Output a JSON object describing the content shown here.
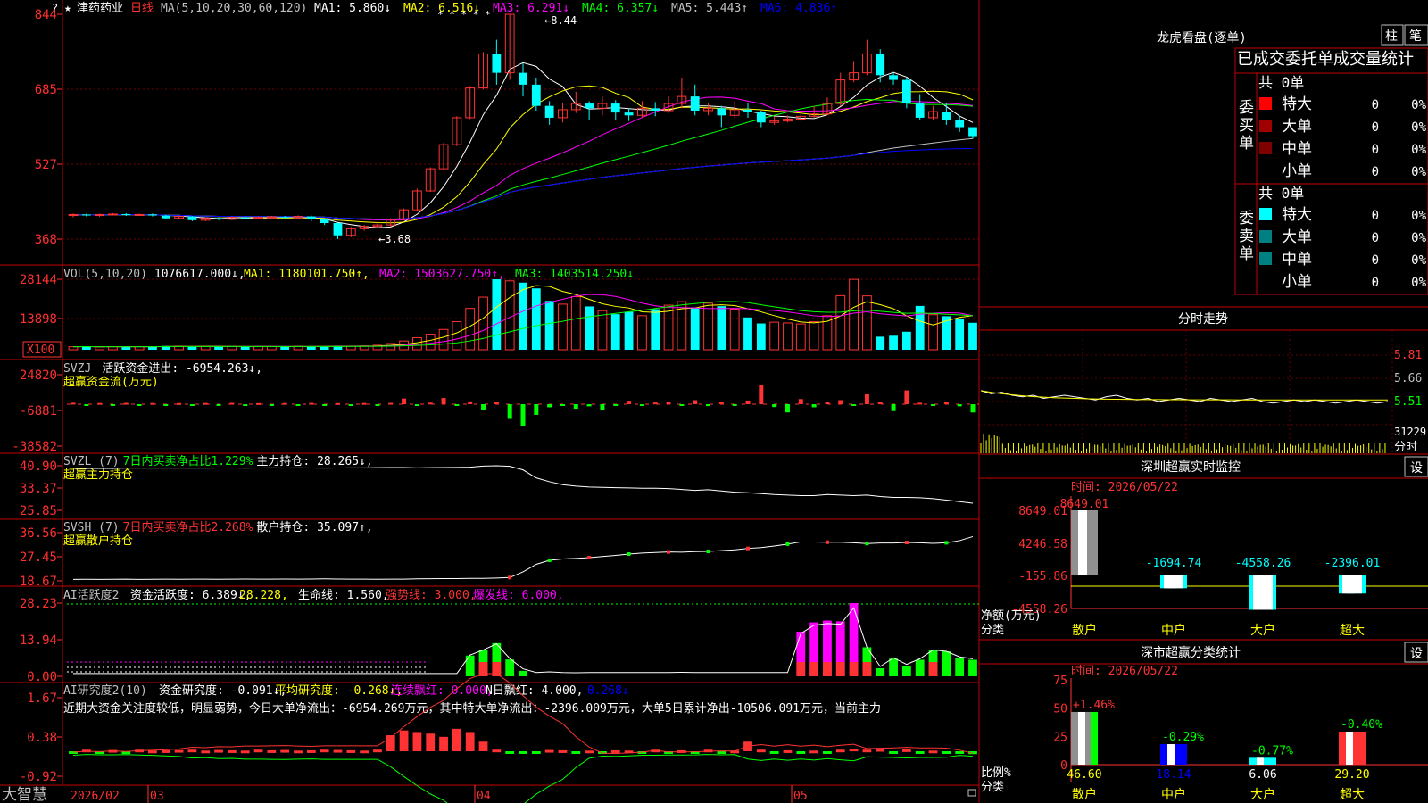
{
  "colors": {
    "up": "#ff3333",
    "down": "#00ffff",
    "ma1": "#ffffff",
    "ma2": "#ffff00",
    "ma3": "#ff00ff",
    "ma4": "#00ff00",
    "ma5": "#c0c0c0",
    "ma6": "#0000ff",
    "grid": "#800000",
    "axis": "#ff3030",
    "text": "#c0c0c0",
    "yellow": "#ffff00",
    "green": "#00ff00",
    "cyan": "#00ffff",
    "magenta": "#ff00ff",
    "white": "#ffffff"
  },
  "main": {
    "stock_name": "津药药业",
    "period": "日线",
    "ma_title": "MA(5,10,20,30,60,120)",
    "ma_values": [
      {
        "label": "MA1: 5.860↓",
        "color": "#ffffff"
      },
      {
        "label": "MA2: 6.516↓",
        "color": "#ffff00"
      },
      {
        "label": "MA3: 6.291↓",
        "color": "#ff00ff"
      },
      {
        "label": "MA4: 6.357↓",
        "color": "#00ff00"
      },
      {
        "label": "MA5: 5.443↑",
        "color": "#c0c0c0"
      },
      {
        "label": "MA6: 4.836↑",
        "color": "#0000ff"
      }
    ],
    "y_ticks": [
      "844",
      "685",
      "527",
      "368"
    ],
    "high_label": "8.44",
    "low_label": "3.68",
    "star_marks": "* * * * *",
    "question_mark": "?"
  },
  "vol": {
    "title": "VOL(5,10,20)",
    "value": "1076617.000↓,",
    "ma_values": [
      {
        "label": "MA1: 1180101.750↑,",
        "color": "#ffff00"
      },
      {
        "label": "MA2: 1503627.750↑,",
        "color": "#ff00ff"
      },
      {
        "label": "MA3: 1403514.250↓",
        "color": "#00ff00"
      }
    ],
    "y_ticks": [
      "28144",
      "13898"
    ],
    "unit": "X100"
  },
  "svzj": {
    "title": "SVZJ",
    "label": "活跃资金进出: -6954.263↓,",
    "sub": "超赢资金流(万元)",
    "y_ticks": [
      "24820",
      "-6881",
      "-38582"
    ]
  },
  "svzl": {
    "title": "SVZL (7)",
    "label1": "7日内买卖净占比1.229%",
    "label2": "主力持仓: 28.265↓,",
    "sub": "超赢主力持仓",
    "y_ticks": [
      "40.90",
      "33.37",
      "25.85"
    ]
  },
  "svsh": {
    "title": "SVSH (7)",
    "label1": "7日内买卖净占比2.268%",
    "label2": "散户持仓: 35.097↑,",
    "sub": "超赢散户持仓",
    "y_ticks": [
      "36.56",
      "27.45",
      "18.67"
    ]
  },
  "ai1": {
    "title": "AI活跃度2",
    "labels": [
      {
        "t": "资金活跃度: 6.389↓,",
        "c": "#ffffff"
      },
      {
        "t": "28.228,",
        "c": "#ffff00"
      },
      {
        "t": "生命线: 1.560,",
        "c": "#ffffff"
      },
      {
        "t": "强势线: 3.000,",
        "c": "#ff3333"
      },
      {
        "t": "爆发线: 6.000,",
        "c": "#ff00ff"
      }
    ],
    "y_ticks": [
      "28.23",
      "13.94",
      "0.00"
    ]
  },
  "ai2": {
    "title": "AI研究度2(10)",
    "labels": [
      {
        "t": "资金研究度: -0.091↓,",
        "c": "#ffffff"
      },
      {
        "t": "平均研究度: -0.268↓,",
        "c": "#ffff00"
      },
      {
        "t": "连续飘红: 0.000,",
        "c": "#ff00ff"
      },
      {
        "t": "N日飘红: 4.000,",
        "c": "#ffffff"
      },
      {
        "t": "-0.268↓",
        "c": "#0000ff"
      }
    ],
    "comment": "近期大资金关注度较低，明显弱势，今日大单净流出：-6954.269万元，其中特大单净流出：-2396.009万元，大单5日累计净出-10506.091万元，当前主力",
    "y_ticks": [
      "1.67",
      "0.38",
      "-0.92"
    ]
  },
  "bottom": {
    "logo": "大智慧",
    "dates": [
      "2026/02",
      "03",
      "04",
      "05"
    ]
  },
  "right": {
    "lhb_title": "龙虎看盘(逐单)",
    "btn1": "柱",
    "btn2": "笔",
    "table_header": "已成交委托单成交量统计",
    "buy_group": "委买单",
    "sell_group": "委卖单",
    "buy_total": "共 0单",
    "sell_total": "共 0单",
    "buy_rows": [
      {
        "name": "特大",
        "count": "0",
        "pct": "0%",
        "color": "#ff0000"
      },
      {
        "name": "大单",
        "count": "0",
        "pct": "0%",
        "color": "#a00000"
      },
      {
        "name": "中单",
        "count": "0",
        "pct": "0%",
        "color": "#800000"
      },
      {
        "name": "小单",
        "count": "0",
        "pct": "0%",
        "color": ""
      }
    ],
    "sell_rows": [
      {
        "name": "特大",
        "count": "0",
        "pct": "0%",
        "color": "#00ffff"
      },
      {
        "name": "大单",
        "count": "0",
        "pct": "0%",
        "color": "#008080"
      },
      {
        "name": "中单",
        "count": "0",
        "pct": "0%",
        "color": "#008080"
      },
      {
        "name": "小单",
        "count": "0",
        "pct": "0%",
        "color": ""
      }
    ],
    "intraday_title": "分时走势",
    "intraday_ticks": [
      "5.81",
      "5.66",
      "5.51"
    ],
    "intraday_vol": "31229",
    "intraday_unit": "分时",
    "monitor_title": "深圳超赢实时监控",
    "monitor_btn": "设",
    "monitor_time": "时间: 2026/05/22",
    "monitor_y_ticks": [
      "8649.01",
      "4246.58",
      "-155.86",
      "-4558.26"
    ],
    "monitor_unit": "净额(万元)",
    "monitor_cat_label": "分类",
    "monitor_cats": [
      "散户",
      "中户",
      "大户",
      "超大"
    ],
    "monitor_values": [
      "8649.01",
      "-1694.74",
      "-4558.26",
      "-2396.01"
    ],
    "stat_title": "深市超赢分类统计",
    "stat_btn": "设",
    "stat_time": "时间: 2026/05/22",
    "stat_y_ticks": [
      "75",
      "50",
      "25",
      "0"
    ],
    "stat_unit": "比例%",
    "stat_cat_label": "分类",
    "stat_cats": [
      "散户",
      "中户",
      "大户",
      "超大"
    ],
    "stat_values": [
      "46.60",
      "18.14",
      "6.06",
      "29.20"
    ],
    "stat_changes": [
      "+1.46%",
      "-0.29%",
      "-0.77%",
      "-0.40%"
    ]
  },
  "chart_data": [
    {
      "type": "candlestick",
      "name": "price",
      "ylim": [
        3.5,
        8.5
      ],
      "candles": [
        [
          4.18,
          4.2,
          4.22,
          4.14
        ],
        [
          4.2,
          4.18,
          4.22,
          4.16
        ],
        [
          4.18,
          4.2,
          4.22,
          4.15
        ],
        [
          4.2,
          4.21,
          4.23,
          4.18
        ],
        [
          4.21,
          4.19,
          4.23,
          4.17
        ],
        [
          4.19,
          4.2,
          4.22,
          4.17
        ],
        [
          4.2,
          4.18,
          4.22,
          4.16
        ],
        [
          4.18,
          4.12,
          4.19,
          4.1
        ],
        [
          4.12,
          4.16,
          4.18,
          4.1
        ],
        [
          4.16,
          4.08,
          4.17,
          4.06
        ],
        [
          4.08,
          4.12,
          4.14,
          4.06
        ],
        [
          4.12,
          4.1,
          4.14,
          4.08
        ],
        [
          4.1,
          4.14,
          4.16,
          4.08
        ],
        [
          4.14,
          4.12,
          4.16,
          4.1
        ],
        [
          4.12,
          4.14,
          4.16,
          4.1
        ],
        [
          4.14,
          4.15,
          4.17,
          4.12
        ],
        [
          4.15,
          4.13,
          4.17,
          4.11
        ],
        [
          4.13,
          4.16,
          4.18,
          4.11
        ],
        [
          4.16,
          4.1,
          4.18,
          4.05
        ],
        [
          4.1,
          4.02,
          4.12,
          3.98
        ],
        [
          4.02,
          3.76,
          4.03,
          3.68
        ],
        [
          3.76,
          3.9,
          3.94,
          3.72
        ],
        [
          3.9,
          3.95,
          3.98,
          3.86
        ],
        [
          3.95,
          3.98,
          4.05,
          3.92
        ],
        [
          3.98,
          4.1,
          4.12,
          3.95
        ],
        [
          4.1,
          4.3,
          4.33,
          4.08
        ],
        [
          4.3,
          4.7,
          4.75,
          4.28
        ],
        [
          4.7,
          5.17,
          5.2,
          4.68
        ],
        [
          5.17,
          5.68,
          5.72,
          5.15
        ],
        [
          5.68,
          6.25,
          6.28,
          5.65
        ],
        [
          6.25,
          6.88,
          6.92,
          6.22
        ],
        [
          6.88,
          7.6,
          7.64,
          6.85
        ],
        [
          7.6,
          7.2,
          7.9,
          6.95
        ],
        [
          7.2,
          8.44,
          8.44,
          7.05
        ],
        [
          7.2,
          6.95,
          7.4,
          6.7
        ],
        [
          6.95,
          6.5,
          7.1,
          6.4
        ],
        [
          6.5,
          6.25,
          6.6,
          6.1
        ],
        [
          6.25,
          6.42,
          6.55,
          6.15
        ],
        [
          6.42,
          6.55,
          6.8,
          6.35
        ],
        [
          6.55,
          6.45,
          6.6,
          6.2
        ],
        [
          6.45,
          6.55,
          6.7,
          6.3
        ],
        [
          6.55,
          6.36,
          6.62,
          6.2
        ],
        [
          6.36,
          6.3,
          6.45,
          6.18
        ],
        [
          6.3,
          6.45,
          6.6,
          6.25
        ],
        [
          6.45,
          6.4,
          6.58,
          6.28
        ],
        [
          6.4,
          6.55,
          6.7,
          6.35
        ],
        [
          6.55,
          6.7,
          7.1,
          6.45
        ],
        [
          6.7,
          6.4,
          6.95,
          6.3
        ],
        [
          6.4,
          6.45,
          6.55,
          6.3
        ],
        [
          6.45,
          6.3,
          6.5,
          6.05
        ],
        [
          6.3,
          6.42,
          6.6,
          6.25
        ],
        [
          6.42,
          6.38,
          6.55,
          6.25
        ],
        [
          6.38,
          6.15,
          6.4,
          6.05
        ],
        [
          6.15,
          6.18,
          6.28,
          6.1
        ],
        [
          6.18,
          6.22,
          6.3,
          6.15
        ],
        [
          6.22,
          6.28,
          6.4,
          6.18
        ],
        [
          6.28,
          6.33,
          6.5,
          6.25
        ],
        [
          6.33,
          6.55,
          6.68,
          6.3
        ],
        [
          6.55,
          7.05,
          7.2,
          6.5
        ],
        [
          7.05,
          7.2,
          7.45,
          7.0
        ],
        [
          7.2,
          7.6,
          7.9,
          7.15
        ],
        [
          7.6,
          7.15,
          7.7,
          7.0
        ],
        [
          7.15,
          7.05,
          7.2,
          6.95
        ],
        [
          7.05,
          6.55,
          7.1,
          6.45
        ],
        [
          6.55,
          6.25,
          6.75,
          6.2
        ],
        [
          6.25,
          6.38,
          6.5,
          6.2
        ],
        [
          6.38,
          6.2,
          6.55,
          6.1
        ],
        [
          6.2,
          6.05,
          6.3,
          5.95
        ],
        [
          6.05,
          5.86,
          6.05,
          5.8
        ]
      ]
    },
    {
      "type": "bar",
      "name": "volume",
      "unit": "X100",
      "values": [
        1200,
        1300,
        1100,
        1250,
        1180,
        1220,
        1300,
        1500,
        1400,
        1350,
        1280,
        1320,
        1260,
        1300,
        1250,
        1270,
        1220,
        1350,
        1450,
        1300,
        1600,
        1400,
        1500,
        1800,
        2500,
        3500,
        4800,
        6200,
        8100,
        11200,
        16500,
        21000,
        28144,
        27500,
        26800,
        24500,
        19500,
        18200,
        21200,
        17300,
        15600,
        14200,
        15100,
        13600,
        16200,
        17800,
        19200,
        16800,
        18600,
        17400,
        16200,
        12900,
        10500,
        11000,
        10700,
        10300,
        11200,
        13600,
        21600,
        28100,
        21500,
        5200,
        5600,
        7200,
        17500,
        14000,
        13400,
        12500,
        10766
      ],
      "ylim": [
        0,
        30000
      ]
    },
    {
      "type": "bar",
      "name": "SVZJ",
      "unit": "万元",
      "values": [
        1200,
        -900,
        1000,
        -1100,
        1100,
        -900,
        1000,
        -1000,
        900,
        -1100,
        1000,
        -900,
        1100,
        -1000,
        900,
        -1100,
        1000,
        -900,
        1100,
        -1000,
        900,
        -1100,
        1000,
        -900,
        1100,
        4800,
        -1400,
        1300,
        5200,
        -1500,
        2400,
        -5200,
        1800,
        -12400,
        -18800,
        -9000,
        -2600,
        -1400,
        -3800,
        -1800,
        -4600,
        -1300,
        2900,
        -1200,
        1400,
        1800,
        -1400,
        3400,
        -1600,
        1600,
        -1400,
        3100,
        16500,
        -2400,
        -6900,
        4300,
        -2600,
        1500,
        3400,
        -1300,
        8300,
        2100,
        -5800,
        11600,
        1200,
        -1400,
        1600,
        -1800,
        -6954
      ]
    },
    {
      "type": "line",
      "name": "SVZL",
      "values": [
        40.05,
        40.0,
        40.05,
        40.0,
        40.1,
        40.1,
        40.1,
        40.1,
        40.15,
        40.1,
        40.1,
        40.15,
        40.15,
        40.1,
        40.15,
        40.2,
        40.15,
        40.2,
        40.15,
        40.1,
        40.15,
        40.2,
        40.2,
        40.25,
        40.3,
        40.3,
        40.2,
        40.25,
        40.3,
        40.35,
        40.4,
        40.8,
        40.9,
        40.7,
        39.5,
        36.8,
        35.5,
        34.5,
        34.0,
        33.7,
        33.6,
        33.5,
        33.4,
        33.3,
        33.3,
        33.2,
        32.9,
        32.6,
        32.8,
        32.4,
        32.0,
        31.8,
        31.5,
        31.2,
        31.0,
        30.8,
        30.8,
        31.2,
        31.0,
        30.8,
        31.0,
        30.5,
        30.2,
        30.2,
        30.1,
        29.8,
        29.3,
        28.8,
        28.265
      ]
    },
    {
      "type": "line",
      "name": "SVSH",
      "values": [
        19.2,
        19.25,
        19.2,
        19.25,
        19.3,
        19.2,
        19.25,
        19.3,
        19.25,
        19.3,
        19.3,
        19.25,
        19.3,
        19.35,
        19.3,
        19.3,
        19.35,
        19.3,
        19.35,
        19.4,
        19.35,
        19.3,
        19.3,
        19.25,
        19.3,
        19.3,
        19.4,
        19.45,
        19.5,
        19.5,
        19.6,
        19.6,
        19.7,
        19.9,
        22.0,
        24.8,
        26.3,
        26.8,
        27.0,
        27.3,
        27.7,
        28.1,
        28.6,
        29.0,
        29.2,
        29.4,
        29.3,
        29.5,
        29.6,
        29.9,
        30.2,
        30.7,
        31.0,
        31.6,
        32.3,
        33.1,
        33.1,
        33.0,
        33.0,
        32.8,
        32.5,
        32.7,
        32.7,
        32.9,
        32.8,
        32.6,
        32.8,
        33.6,
        35.097
      ]
    },
    {
      "type": "bar",
      "name": "AI活跃度2",
      "values": [
        0.1,
        0.1,
        0.1,
        0.1,
        0.1,
        0.1,
        0.1,
        0.1,
        0.1,
        0.1,
        0.1,
        0.1,
        0.1,
        0.1,
        0.1,
        0.1,
        0.1,
        0.1,
        0.1,
        0.1,
        0.1,
        0.1,
        0.1,
        0.1,
        0.1,
        0.1,
        0.1,
        0.1,
        0.1,
        0.1,
        8.0,
        10.2,
        12.8,
        6.5,
        2.1,
        0.5,
        0.8,
        0.5,
        0.4,
        0.5,
        0.5,
        0.5,
        0.5,
        0.5,
        0.5,
        0.5,
        0.6,
        0.5,
        0.5,
        0.5,
        0.5,
        0.5,
        0.5,
        0.5,
        0.5,
        17.2,
        20.8,
        21.5,
        21.2,
        28.23,
        11.2,
        3.1,
        6.8,
        4.0,
        6.389,
        10.2,
        9.6,
        7.2,
        6.389
      ],
      "ylim": [
        0,
        28.23
      ]
    },
    {
      "type": "bar",
      "name": "AI研究度2",
      "values": [
        -0.05,
        0.05,
        -0.02,
        0.04,
        -0.03,
        0.05,
        0.02,
        0.03,
        0.04,
        0.05,
        0.02,
        0.04,
        0.03,
        0.02,
        0.05,
        0.03,
        0.04,
        0.02,
        0.03,
        0.05,
        0.04,
        0.03,
        0.02,
        0.05,
        0.5,
        0.65,
        0.6,
        0.55,
        0.45,
        0.7,
        0.6,
        0.3,
        0.05,
        -0.02,
        -0.08,
        -0.05,
        0.04,
        0.03,
        -0.05,
        0.02,
        -0.05,
        0.03,
        0.02,
        -0.04,
        0.05,
        -0.05,
        0.03,
        -0.04,
        0.05,
        -0.03,
        0.02,
        0.3,
        0.05,
        -0.04,
        0.03,
        -0.05,
        0.02,
        -0.04,
        0.05,
        0.08,
        0.05,
        0.07,
        -0.02,
        0.06,
        -0.08,
        0.02,
        -0.05,
        -0.07,
        -0.091
      ],
      "ylim": [
        -0.92,
        1.67
      ]
    },
    {
      "type": "line",
      "name": "intraday",
      "values": [
        5.58,
        5.56,
        5.57,
        5.55,
        5.54,
        5.55,
        5.53,
        5.54,
        5.55,
        5.54,
        5.53,
        5.52,
        5.54,
        5.55,
        5.53,
        5.52,
        5.53,
        5.51,
        5.52,
        5.53,
        5.52,
        5.51,
        5.53,
        5.52,
        5.51,
        5.52,
        5.53,
        5.51,
        5.5,
        5.51,
        5.52,
        5.51,
        5.52,
        5.51,
        5.5,
        5.51,
        5.52,
        5.51,
        5.5,
        5.51
      ],
      "ylim": [
        5.44,
        5.88
      ]
    },
    {
      "type": "bar",
      "name": "深圳超赢实时监控",
      "categories": [
        "散户",
        "中户",
        "大户",
        "超大"
      ],
      "values": [
        8649.01,
        -1694.74,
        -4558.26,
        -2396.01
      ]
    },
    {
      "type": "bar",
      "name": "深市超赢分类统计",
      "categories": [
        "散户",
        "中户",
        "大户",
        "超大"
      ],
      "values": [
        46.6,
        18.14,
        6.06,
        29.2
      ],
      "ylim": [
        0,
        75
      ]
    }
  ]
}
